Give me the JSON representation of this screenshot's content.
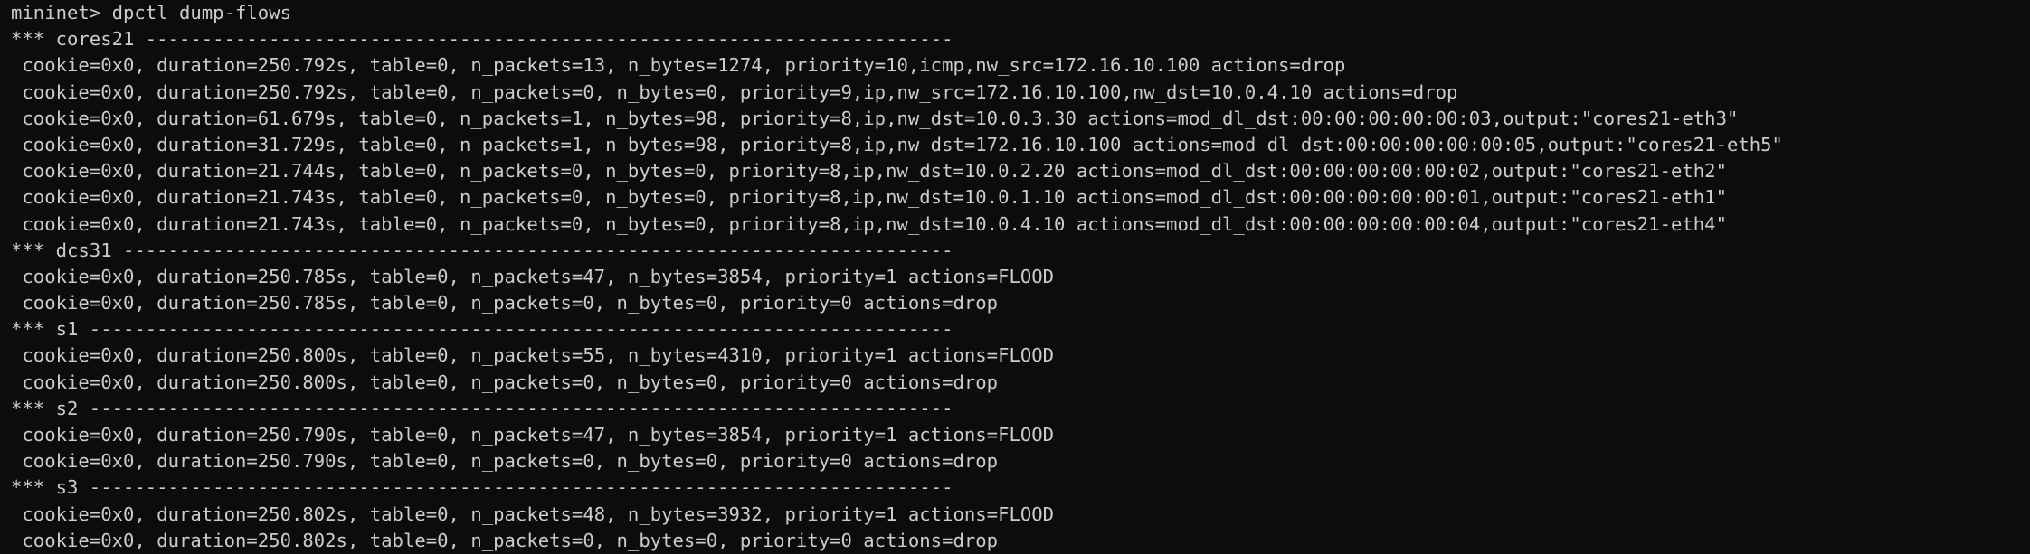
{
  "terminal": {
    "lines": [
      "mininet> dpctl dump-flows",
      "*** cores21 ------------------------------------------------------------------------",
      " cookie=0x0, duration=250.792s, table=0, n_packets=13, n_bytes=1274, priority=10,icmp,nw_src=172.16.10.100 actions=drop",
      " cookie=0x0, duration=250.792s, table=0, n_packets=0, n_bytes=0, priority=9,ip,nw_src=172.16.10.100,nw_dst=10.0.4.10 actions=drop",
      " cookie=0x0, duration=61.679s, table=0, n_packets=1, n_bytes=98, priority=8,ip,nw_dst=10.0.3.30 actions=mod_dl_dst:00:00:00:00:00:03,output:\"cores21-eth3\"",
      " cookie=0x0, duration=31.729s, table=0, n_packets=1, n_bytes=98, priority=8,ip,nw_dst=172.16.10.100 actions=mod_dl_dst:00:00:00:00:00:05,output:\"cores21-eth5\"",
      " cookie=0x0, duration=21.744s, table=0, n_packets=0, n_bytes=0, priority=8,ip,nw_dst=10.0.2.20 actions=mod_dl_dst:00:00:00:00:00:02,output:\"cores21-eth2\"",
      " cookie=0x0, duration=21.743s, table=0, n_packets=0, n_bytes=0, priority=8,ip,nw_dst=10.0.1.10 actions=mod_dl_dst:00:00:00:00:00:01,output:\"cores21-eth1\"",
      " cookie=0x0, duration=21.743s, table=0, n_packets=0, n_bytes=0, priority=8,ip,nw_dst=10.0.4.10 actions=mod_dl_dst:00:00:00:00:00:04,output:\"cores21-eth4\"",
      "*** dcs31 --------------------------------------------------------------------------",
      " cookie=0x0, duration=250.785s, table=0, n_packets=47, n_bytes=3854, priority=1 actions=FLOOD",
      " cookie=0x0, duration=250.785s, table=0, n_packets=0, n_bytes=0, priority=0 actions=drop",
      "*** s1 -----------------------------------------------------------------------------",
      " cookie=0x0, duration=250.800s, table=0, n_packets=55, n_bytes=4310, priority=1 actions=FLOOD",
      " cookie=0x0, duration=250.800s, table=0, n_packets=0, n_bytes=0, priority=0 actions=drop",
      "*** s2 -----------------------------------------------------------------------------",
      " cookie=0x0, duration=250.790s, table=0, n_packets=47, n_bytes=3854, priority=1 actions=FLOOD",
      " cookie=0x0, duration=250.790s, table=0, n_packets=0, n_bytes=0, priority=0 actions=drop",
      "*** s3 -----------------------------------------------------------------------------",
      " cookie=0x0, duration=250.802s, table=0, n_packets=48, n_bytes=3932, priority=1 actions=FLOOD",
      " cookie=0x0, duration=250.802s, table=0, n_packets=0, n_bytes=0, priority=0 actions=drop"
    ]
  },
  "colors": {
    "background": "#0c0c0c",
    "text": "#cccccc"
  }
}
